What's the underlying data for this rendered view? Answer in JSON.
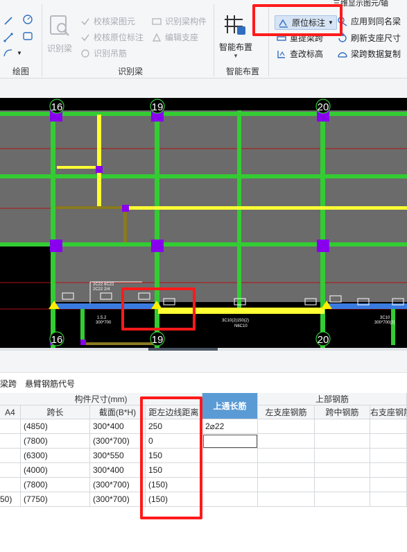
{
  "ribbon": {
    "draw_group": {
      "label": "绘图"
    },
    "identify_group": {
      "label": "识别梁",
      "big_button": "识别梁",
      "buttons": [
        "校核梁图元",
        "校核原位标注",
        "识别吊筋",
        "识别梁构件",
        "编辑支座"
      ]
    },
    "smart_group": {
      "label": "智能布置",
      "big_button": "智能布置"
    },
    "beam_group": {
      "top_right_text": "三维显示图元/轴",
      "buttons": [
        "原位标注",
        "应用到同名梁",
        "重提梁跨",
        "刷新支座尺寸",
        "查改标高",
        "梁跨数据复制"
      ]
    }
  },
  "canvas": {
    "axis_labels_top": [
      "16",
      "19",
      "20"
    ],
    "axis_labels_bottom": [
      "16",
      "19",
      "20"
    ],
    "beam_annotation_left": [
      "1.5.2",
      "300*700"
    ],
    "beam_annotation_mid": [
      "3C10(2)150(2)",
      "N6C10"
    ],
    "beam_annotation_right": [
      "3C10",
      "300*700(2)"
    ],
    "dim_texts": [
      "2C22 6C22",
      "2C22 2/4"
    ]
  },
  "tabs": {
    "items": [
      "梁跨",
      "悬臂钢筋代号"
    ]
  },
  "table": {
    "group_headers": [
      "构件尺寸(mm)",
      "上部钢筋"
    ],
    "headers": [
      "A4",
      "跨长",
      "截面(B*H)",
      "距左边线距离",
      "上通长筋",
      "左支座钢筋",
      "跨中钢筋",
      "右支座钢筋"
    ],
    "rows": [
      [
        "",
        "(4850)",
        "300*400",
        "250",
        "2⌀22",
        "",
        "",
        ""
      ],
      [
        "",
        "(7800)",
        "(300*700)",
        "0",
        "",
        "",
        "",
        ""
      ],
      [
        "",
        "(6300)",
        "300*550",
        "150",
        "",
        "",
        "",
        ""
      ],
      [
        "",
        "(4000)",
        "300*400",
        "150",
        "",
        "",
        "",
        ""
      ],
      [
        "",
        "(7800)",
        "(300*700)",
        "(150)",
        "",
        "",
        "",
        ""
      ],
      [
        "50)",
        "(7750)",
        "(300*700)",
        "(150)",
        "",
        "",
        "",
        ""
      ]
    ]
  },
  "colors": {
    "highlight": "#ff1a1a",
    "beam_green": "#33cc33",
    "beam_yellow": "#ffff33",
    "column_purple": "#8800ee",
    "header_selected": "#5b9bd5"
  }
}
